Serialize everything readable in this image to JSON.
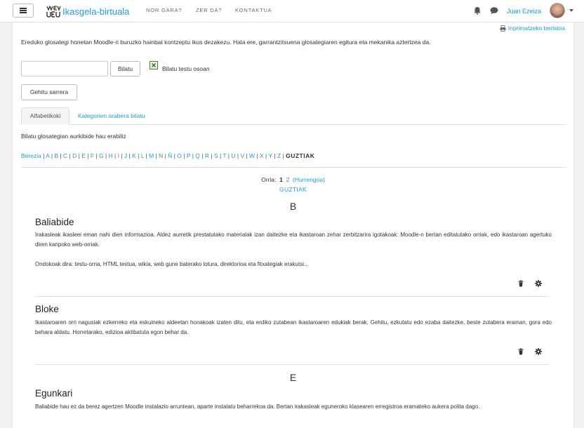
{
  "navbar": {
    "brand": "Ikasgela-birtuala",
    "logo_text": "UEU",
    "items": [
      "NOR GARA?",
      "ZER DA?",
      "KONTAKTUA"
    ],
    "username": "Juan Ezeiza"
  },
  "page": {
    "printer_link": "Inprimatzeko bertsioa",
    "intro": "Ereduko glosategi honetan Moodle-ri buruzko hainbat kontzeptu ikus dezakezu. Hala ere, garrantzitsuena glosategiaren egitura eta mekanika aztertzea da.",
    "search": {
      "value": "",
      "placeholder": "",
      "button": "Bilatu",
      "fulltext_label": "Bilatu testu osoan",
      "fulltext_checked": true
    },
    "add_entry_button": "Gehitu sarrera",
    "tabs": [
      "Alfabetikoki",
      "Kategorien arabera bilatu"
    ],
    "browse_label": "Bilatu glosategian aurkibide hau erabiliz",
    "alphabet": [
      "Berezia",
      "A",
      "B",
      "C",
      "D",
      "E",
      "F",
      "G",
      "H",
      "I",
      "J",
      "K",
      "L",
      "M",
      "N",
      "Ñ",
      "O",
      "P",
      "Q",
      "R",
      "S",
      "T",
      "U",
      "V",
      "W",
      "X",
      "Y",
      "Z"
    ],
    "alphabet_all": "GUZTIAK",
    "pager": {
      "label": "Orria:",
      "current": "1",
      "next_page": "2",
      "next_label": "(Hurrengoa)",
      "all": "GUZTIAK"
    }
  },
  "entries": [
    {
      "letter": "B",
      "title": "Baliabide",
      "text1": "Irakasleak ikasleei eman nahi dien informazioa. Aldez aurretik prestatutako materialak izan daitezke eta ikastaroan zehar zerbitzarira igotakoak: Moodle-n bertan editatutako orriak, edo ikastaroan agertuko diren kanpoko web-orriak.",
      "text2": "Ondokoak dira: testu-orria, HTML testua, wikia, web gune baterako lotura, direktorioa eta fitxategiak erakutsi..."
    },
    {
      "title": "Bloke",
      "text1": "Ikastaroaren orri nagusiak ezkerreko eta eskuineko aldeetan honakoak izaten ditu, eta erdiko zutabean ikastaroaren edukiak berak. Gehitu, ezkutatu edo ezaba daitezke, beste zutabera eraman, gora edo behara aldatu. Horretarako, edizioa aktibatuta egon behar da."
    },
    {
      "letter": "E",
      "title": "Egunkari",
      "text1": "Baliabide hau ez da berez agertzen Moodle instalazio arruntean, aparte instalatu beharrekoa da. Bertan irakasleak eguneroko klasearen erregistroa eramateko aukera polita dago."
    }
  ]
}
